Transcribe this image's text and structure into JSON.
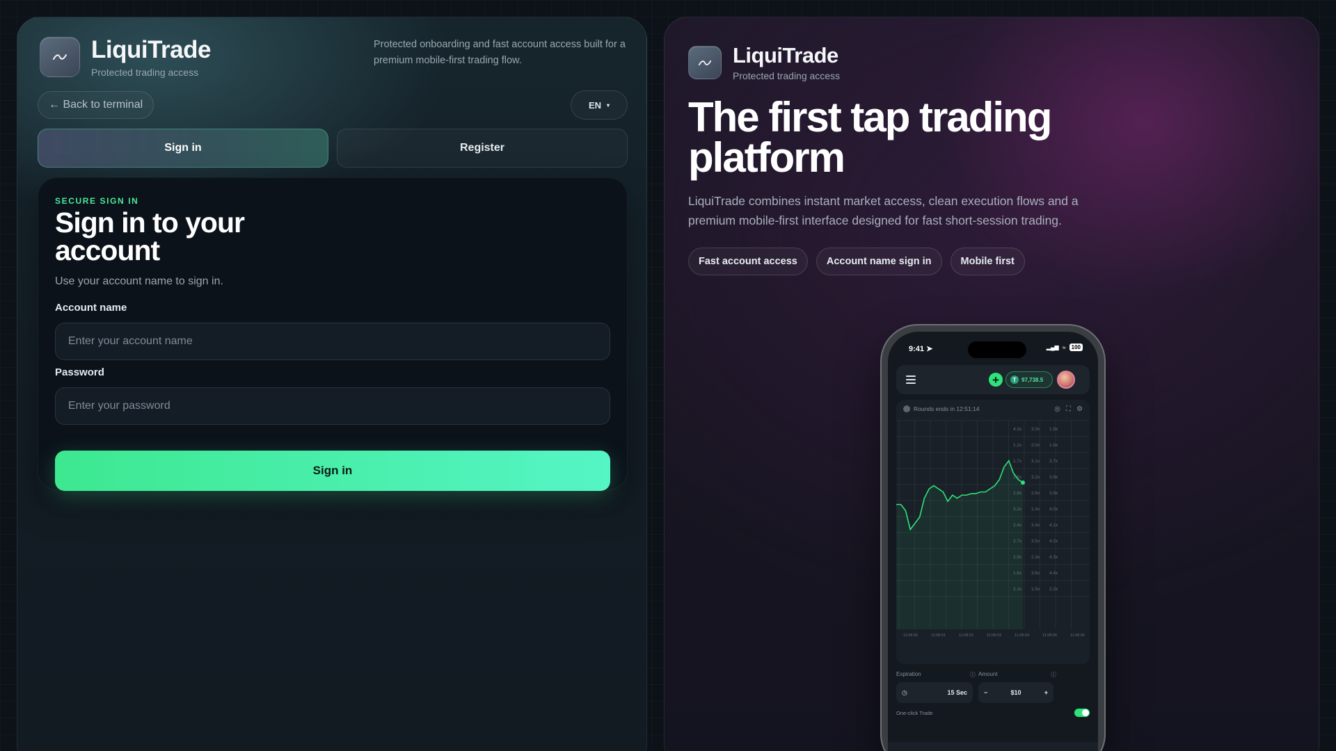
{
  "brand": {
    "name": "LiquiTrade",
    "subtitle": "Protected trading access"
  },
  "left": {
    "tagline": "Protected onboarding and fast account access built for a premium mobile-first trading flow.",
    "back_label": "← Back to terminal",
    "lang": "EN",
    "tabs": {
      "signin": "Sign in",
      "register": "Register"
    },
    "form": {
      "eyebrow": "SECURE SIGN IN",
      "title": "Sign in to your account",
      "subtitle": "Use your account name to sign in.",
      "account_label": "Account name",
      "account_placeholder": "Enter your account name",
      "password_label": "Password",
      "password_placeholder": "Enter your password",
      "submit": "Sign in"
    }
  },
  "right": {
    "hero_title": "The first tap trading platform",
    "hero_desc": "LiquiTrade combines instant market access, clean execution flows and a premium mobile-first interface designed for fast short-session trading.",
    "chips": [
      "Fast account access",
      "Account name sign in",
      "Mobile first"
    ]
  },
  "phone": {
    "time": "9:41",
    "battery": "100",
    "balance": "97,738.5",
    "rounds_text": "Rounds ends in 12:51:14",
    "expiration_label": "Expiration",
    "expiration_value": "15 Sec",
    "amount_label": "Amount",
    "amount_value": "$10",
    "oneclick_label": "One-click Trade"
  },
  "chart_data": {
    "type": "line",
    "title": "",
    "series": [
      {
        "values": [
          62,
          62,
          58,
          46,
          50,
          54,
          66,
          72,
          74,
          72,
          70,
          64,
          68,
          66,
          68,
          68,
          69,
          69,
          70,
          70,
          72,
          74,
          78,
          86,
          90,
          82,
          78,
          76
        ]
      }
    ],
    "multiplier_columns": [
      [
        "4.3x",
        "1.1x",
        "1.7x",
        "2.5x",
        "2.8x",
        "3.2x",
        "2.4x",
        "2.7x",
        "2.9x",
        "1.6x",
        "2.1x"
      ],
      [
        "3.0x",
        "2.0x",
        "3.1x",
        "3.2x",
        "2.6x",
        "1.4x",
        "3.4x",
        "3.5x",
        "2.3x",
        "3.6x",
        "1.5x"
      ],
      [
        "1.9x",
        "1.6x",
        "3.7x",
        "3.8x",
        "3.9x",
        "4.0x",
        "4.1x",
        "4.2x",
        "4.3x",
        "4.4x",
        "2.2x"
      ]
    ],
    "x_ticks": [
      "11:08:00",
      "11:08:01",
      "11:08:02",
      "11:08:03",
      "11:08:04",
      "11:08:05",
      "11:08:06"
    ],
    "color": "#2ee37c"
  }
}
